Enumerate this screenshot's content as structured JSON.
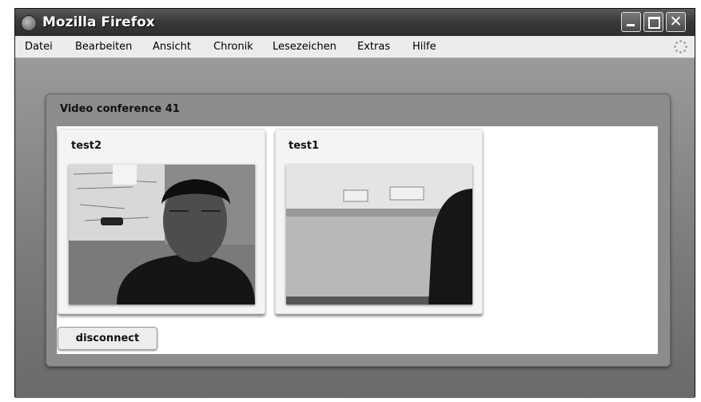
{
  "window": {
    "title": "Mozilla Firefox"
  },
  "menu": [
    "Datei",
    "Bearbeiten",
    "Ansicht",
    "Chronik",
    "Lesezeichen",
    "Extras",
    "Hilfe"
  ],
  "conference": {
    "title": "Video conference 41",
    "participants": [
      {
        "name": "test2"
      },
      {
        "name": "test1"
      }
    ],
    "disconnect_label": "disconnect"
  }
}
